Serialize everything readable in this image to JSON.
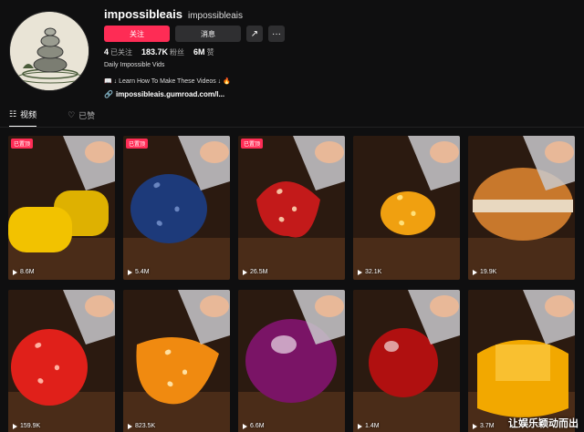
{
  "profile": {
    "username": "impossibleais",
    "handle": "impossibleais",
    "follow_label": "关注",
    "message_label": "消息",
    "share_icon": "share-icon",
    "more_label": "···",
    "stats": [
      {
        "value": "4",
        "label": "已关注"
      },
      {
        "value": "183.7K",
        "label": "粉丝"
      },
      {
        "value": "6M",
        "label": "赞"
      }
    ],
    "bio_line1": "Daily Impossible Vids",
    "bio_line2": "📖 ↓ Learn How To Make These Videos ↓ 🔥",
    "link": "impossibleais.gumroad.com/l..."
  },
  "tabs": [
    {
      "label": "视频",
      "icon": "grid-icon",
      "active": true
    },
    {
      "label": "已赞",
      "icon": "heart-icon",
      "active": false
    }
  ],
  "videos": [
    {
      "views": "8.6M",
      "pinned": "已置顶",
      "subject": "yellow-fruit",
      "color": "#f2c200"
    },
    {
      "views": "5.4M",
      "pinned": "已置顶",
      "subject": "blackberry",
      "color": "#1d3a7a"
    },
    {
      "views": "26.5M",
      "pinned": "已置顶",
      "subject": "strawberry",
      "color": "#c31a1a"
    },
    {
      "views": "32.1K",
      "pinned": "",
      "subject": "orange-berry",
      "color": "#f0a010"
    },
    {
      "views": "19.9K",
      "pinned": "",
      "subject": "donut",
      "color": "#c8782c"
    },
    {
      "views": "159.9K",
      "pinned": "",
      "subject": "pomegranate",
      "color": "#e0201a"
    },
    {
      "views": "823.5K",
      "pinned": "",
      "subject": "orange-strawberry",
      "color": "#f08a10"
    },
    {
      "views": "6.6M",
      "pinned": "",
      "subject": "onion",
      "color": "#7a1466"
    },
    {
      "views": "1.4M",
      "pinned": "",
      "subject": "cherry",
      "color": "#b01010"
    },
    {
      "views": "3.7M",
      "pinned": "",
      "subject": "honey-jelly",
      "color": "#f2a800"
    }
  ],
  "watermark": "让娱乐颖动而出"
}
